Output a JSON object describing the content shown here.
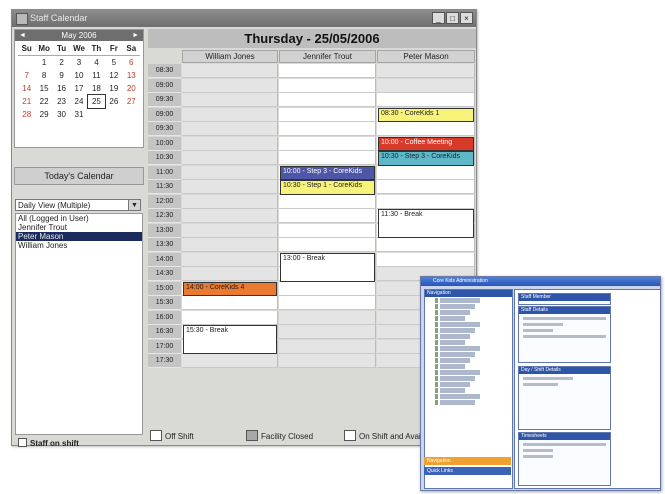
{
  "window": {
    "title": "Staff Calendar",
    "min": "_",
    "max": "□",
    "close": "×"
  },
  "mini_calendar": {
    "month": "May 2006",
    "prev": "◄",
    "next": "►",
    "weekdays": [
      "Su",
      "Mo",
      "Tu",
      "We",
      "Th",
      "Fr",
      "Sa"
    ],
    "days": [
      "",
      "1",
      "2",
      "3",
      "4",
      "5",
      "6",
      "7",
      "8",
      "9",
      "10",
      "11",
      "12",
      "13",
      "14",
      "15",
      "16",
      "17",
      "18",
      "19",
      "20",
      "21",
      "22",
      "23",
      "24",
      "25",
      "26",
      "27",
      "28",
      "29",
      "30",
      "31",
      "",
      "",
      ""
    ],
    "selected": "25"
  },
  "todays_calendar": {
    "title": "Today's Calendar",
    "view": "Daily View (Multiple)",
    "users": [
      "All (Logged in User)",
      "Jennifer Trout",
      "Peter Mason",
      "William Jones"
    ],
    "selected_user": "Peter Mason"
  },
  "staff_on_shift": "Staff on shift",
  "schedule": {
    "date_title": "Thursday - 25/05/2006",
    "columns": [
      "William Jones",
      "Jennifer Trout",
      "Peter Mason"
    ],
    "times": [
      "08:30",
      "09:00",
      "09:30",
      "09:00",
      "09:30",
      "10:00",
      "10:30",
      "11:00",
      "11:30",
      "12:00",
      "12:30",
      "13:00",
      "13:30",
      "14:00",
      "14:30",
      "15:00",
      "15:30",
      "16:00",
      "16:30",
      "17:00",
      "17:30"
    ],
    "appointments": [
      {
        "col": 2,
        "row": 3,
        "span": 1,
        "text": "08:30 - CoreKids 1",
        "color": "#f7f27a"
      },
      {
        "col": 2,
        "row": 5,
        "span": 1,
        "text": "10:00 - Coffee Meeting",
        "color": "#d83a2a"
      },
      {
        "col": 2,
        "row": 6,
        "span": 1,
        "text": "10:30 - Step 3 - CoreKids",
        "color": "#5fb8c8"
      },
      {
        "col": 1,
        "row": 7,
        "span": 1,
        "text": "10:00 - Step 3 - CoreKids",
        "color": "#4e56a8"
      },
      {
        "col": 1,
        "row": 8,
        "span": 1,
        "text": "10:30 - Step 1 - CoreKids",
        "color": "#f7f27a"
      },
      {
        "col": 2,
        "row": 10,
        "span": 2,
        "text": "11:30 - Break",
        "color": "#ffffff"
      },
      {
        "col": 1,
        "row": 13,
        "span": 2,
        "text": "13:00 - Break",
        "color": "#ffffff"
      },
      {
        "col": 0,
        "row": 15,
        "span": 1,
        "text": "14:00 - CoreKids 4",
        "color": "#ea7a2f"
      },
      {
        "col": 0,
        "row": 18,
        "span": 2,
        "text": "15:30 - Break",
        "color": "#ffffff"
      }
    ]
  },
  "legend": {
    "off_shift": "Off Shift",
    "facility_closed": "Facility Closed",
    "on_shift": "On Shift and Available"
  },
  "colors": {
    "title": "#7a7a7a",
    "selected": "#1c2b5e",
    "inset_accent": "#2f55a8"
  },
  "inset": {
    "title": "Core Kids Administration",
    "navigation": "Navigation",
    "tab1": "Navigation",
    "tab2": "Quick Links",
    "panel1": "Staff Member",
    "panel2": "Staff Details",
    "panel3": "Day / Shift Details",
    "panel4": "Timesheets"
  }
}
